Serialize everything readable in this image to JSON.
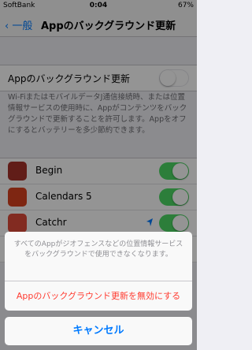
{
  "status_bar": {
    "carrier": "SoftBank",
    "time": "0:04",
    "battery": "67%"
  },
  "nav": {
    "back_label": "一般",
    "title": "Appのバックグラウンド更新"
  },
  "main_toggle": {
    "label": "Appのバックグラウンド更新",
    "on": false
  },
  "description": "Wi-FiまたはモバイルデータJ通信接続時、または位置情報サービスの使用時に、Appがコンテンツをバックグラウンドで更新することを許可します。Appをオフにするとバッテリーを多少節約できます。",
  "apps": [
    {
      "name": "Begin",
      "on": true,
      "icon": "begin-app-icon",
      "color": "#a8322a"
    },
    {
      "name": "Calendars 5",
      "on": true,
      "icon": "calendars-app-icon",
      "color": "#d9421f"
    },
    {
      "name": "Catchr",
      "on": true,
      "icon": "catchr-app-icon",
      "color": "#e04a3a",
      "location": true
    }
  ],
  "action_sheet": {
    "message": "すべてのAppがジオフェンスなどの位置情報サービスをバックグラウンドで使用できなくなります。",
    "destructive_label": "Appのバックグラウンド更新を無効にする",
    "cancel_label": "キャンセル"
  },
  "colors": {
    "accent": "#007aff",
    "destructive": "#ff3b30",
    "switch_on": "#4cd964"
  }
}
